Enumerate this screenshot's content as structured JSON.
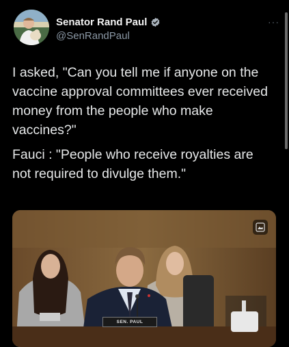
{
  "author": {
    "display_name": "Senator Rand Paul",
    "handle": "@SenRandPaul",
    "verified": true
  },
  "tweet": {
    "paragraphs": [
      "I asked, \"Can you tell me if anyone on the vaccine approval committees ever received money from the people who make vaccines?\"",
      "Fauci : \"People who receive royalties are not required to divulge them.\""
    ]
  },
  "media": {
    "nameplate": "SEN. PAUL"
  },
  "icons": {
    "more": "more-options-icon",
    "verified": "verified-badge-icon",
    "media_badge": "image-icon"
  },
  "colors": {
    "background": "#000000",
    "text": "#e7e9ea",
    "secondary": "#8b98a5",
    "verified": "#8f9ca8"
  }
}
